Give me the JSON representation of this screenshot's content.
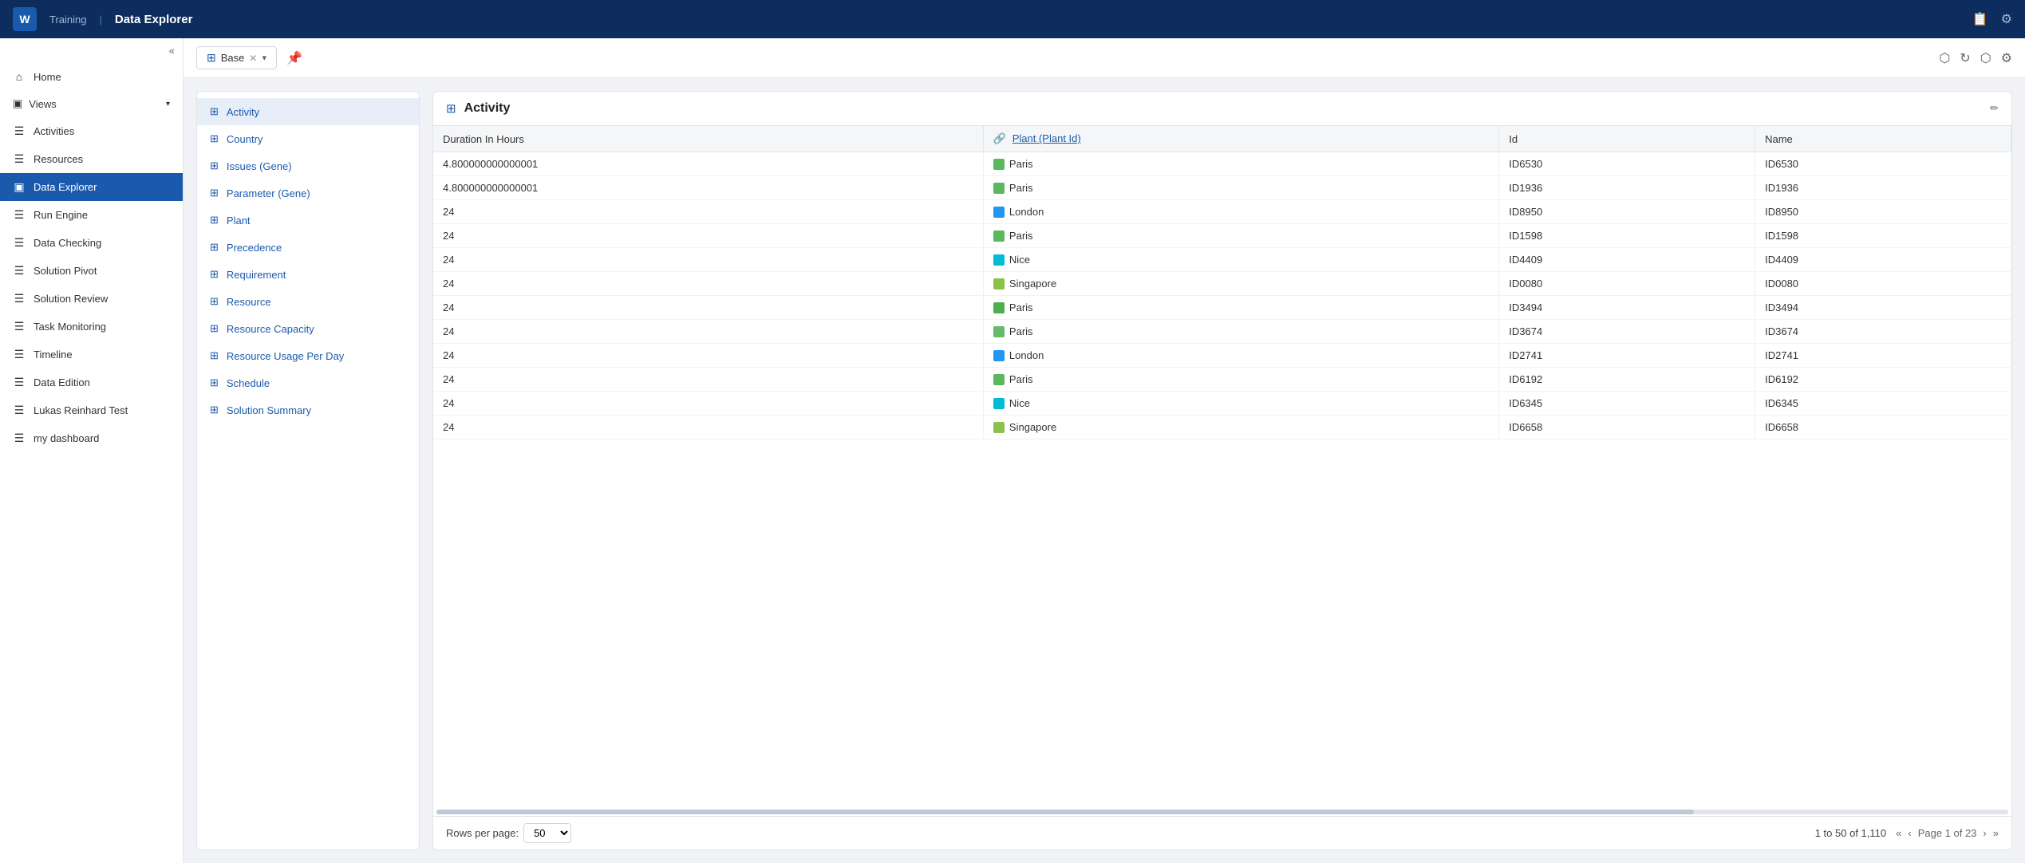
{
  "topnav": {
    "logo": "W",
    "app_label": "Training",
    "title": "Data Explorer"
  },
  "sidebar": {
    "collapse_label": "«",
    "items": [
      {
        "id": "home",
        "icon": "⌂",
        "label": "Home",
        "active": false
      },
      {
        "id": "views",
        "icon": "▣",
        "label": "Views",
        "is_section": true,
        "expanded": true
      },
      {
        "id": "activities",
        "icon": "☰",
        "label": "Activities",
        "active": false
      },
      {
        "id": "resources",
        "icon": "☰",
        "label": "Resources",
        "active": false
      },
      {
        "id": "data-explorer",
        "icon": "▣",
        "label": "Data Explorer",
        "active": true
      },
      {
        "id": "run-engine",
        "icon": "☰",
        "label": "Run Engine",
        "active": false
      },
      {
        "id": "data-checking",
        "icon": "☰",
        "label": "Data Checking",
        "active": false
      },
      {
        "id": "solution-pivot",
        "icon": "☰",
        "label": "Solution Pivot",
        "active": false
      },
      {
        "id": "solution-review",
        "icon": "☰",
        "label": "Solution Review",
        "active": false
      },
      {
        "id": "task-monitoring",
        "icon": "☰",
        "label": "Task Monitoring",
        "active": false
      },
      {
        "id": "timeline",
        "icon": "☰",
        "label": "Timeline",
        "active": false
      },
      {
        "id": "data-edition",
        "icon": "☰",
        "label": "Data Edition",
        "active": false
      },
      {
        "id": "lukas-reinhard",
        "icon": "☰",
        "label": "Lukas Reinhard Test",
        "active": false
      },
      {
        "id": "my-dashboard",
        "icon": "☰",
        "label": "my dashboard",
        "active": false
      }
    ]
  },
  "toolbar": {
    "base_label": "Base",
    "pin_label": "📌"
  },
  "view_list": {
    "items": [
      {
        "id": "activity",
        "label": "Activity",
        "active": true
      },
      {
        "id": "country",
        "label": "Country",
        "active": false
      },
      {
        "id": "issues-gene",
        "label": "Issues (Gene)",
        "active": false
      },
      {
        "id": "parameter-gene",
        "label": "Parameter (Gene)",
        "active": false
      },
      {
        "id": "plant",
        "label": "Plant",
        "active": false
      },
      {
        "id": "precedence",
        "label": "Precedence",
        "active": false
      },
      {
        "id": "requirement",
        "label": "Requirement",
        "active": false
      },
      {
        "id": "resource",
        "label": "Resource",
        "active": false
      },
      {
        "id": "resource-capacity",
        "label": "Resource Capacity",
        "active": false
      },
      {
        "id": "resource-usage-per-day",
        "label": "Resource Usage Per Day",
        "active": false
      },
      {
        "id": "schedule",
        "label": "Schedule",
        "active": false
      },
      {
        "id": "solution-summary",
        "label": "Solution Summary",
        "active": false
      }
    ]
  },
  "data_panel": {
    "title": "Activity",
    "columns": [
      {
        "id": "duration",
        "label": "Duration In Hours"
      },
      {
        "id": "plant",
        "label": "Plant (Plant Id)",
        "is_link": true
      },
      {
        "id": "id",
        "label": "Id"
      },
      {
        "id": "name",
        "label": "Name"
      }
    ],
    "rows": [
      {
        "duration": "4.800000000000001",
        "plant_color": "#5cb85c",
        "plant": "Paris",
        "id": "ID6530",
        "name": "ID6530"
      },
      {
        "duration": "4.800000000000001",
        "plant_color": "#5cb85c",
        "plant": "Paris",
        "id": "ID1936",
        "name": "ID1936"
      },
      {
        "duration": "24",
        "plant_color": "#2196f3",
        "plant": "London",
        "id": "ID8950",
        "name": "ID8950"
      },
      {
        "duration": "24",
        "plant_color": "#5cb85c",
        "plant": "Paris",
        "id": "ID1598",
        "name": "ID1598"
      },
      {
        "duration": "24",
        "plant_color": "#00bcd4",
        "plant": "Nice",
        "id": "ID4409",
        "name": "ID4409"
      },
      {
        "duration": "24",
        "plant_color": "#8bc34a",
        "plant": "Singapore",
        "id": "ID0080",
        "name": "ID0080"
      },
      {
        "duration": "24",
        "plant_color": "#4caf50",
        "plant": "Paris",
        "id": "ID3494",
        "name": "ID3494"
      },
      {
        "duration": "24",
        "plant_color": "#66bb6a",
        "plant": "Paris",
        "id": "ID3674",
        "name": "ID3674"
      },
      {
        "duration": "24",
        "plant_color": "#2196f3",
        "plant": "London",
        "id": "ID2741",
        "name": "ID2741"
      },
      {
        "duration": "24",
        "plant_color": "#5cb85c",
        "plant": "Paris",
        "id": "ID6192",
        "name": "ID6192"
      },
      {
        "duration": "24",
        "plant_color": "#00bcd4",
        "plant": "Nice",
        "id": "ID6345",
        "name": "ID6345"
      },
      {
        "duration": "24",
        "plant_color": "#8bc34a",
        "plant": "Singapore",
        "id": "ID6658",
        "name": "ID6658"
      }
    ],
    "pagination": {
      "rows_per_page_label": "Rows per page:",
      "rows_per_page_value": "50",
      "total_text": "1 to 50 of 1,110",
      "page_text": "Page 1 of 23"
    }
  }
}
